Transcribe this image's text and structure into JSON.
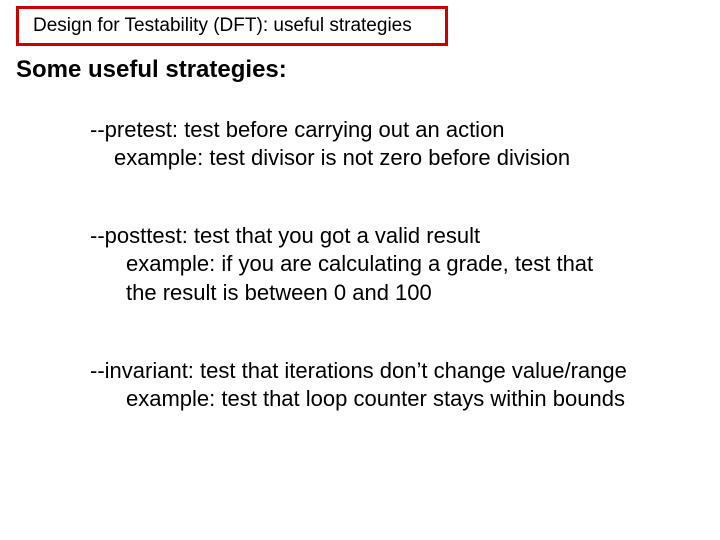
{
  "title": "Design for Testability (DFT):  useful strategies",
  "subheading": "Some useful strategies:",
  "items": [
    {
      "head": "--pretest:  test before carrying out an action",
      "ex1": "example:  test divisor is not zero before division"
    },
    {
      "head": "--posttest:  test that you got a valid result",
      "ex1": "example:  if you are calculating a grade, test that",
      "ex2": " the result is between 0 and 100"
    },
    {
      "head": "--invariant:  test that iterations don’t change value/range",
      "ex1": "example:  test that loop counter stays within bounds"
    }
  ]
}
